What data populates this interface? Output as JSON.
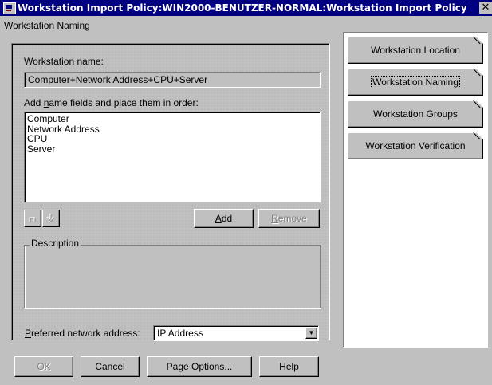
{
  "window": {
    "title": "Workstation Import Policy:WIN2000-BENUTZER-NORMAL:Workstation Import Policy",
    "close_glyph": "✕"
  },
  "page": {
    "heading": "Workstation Naming",
    "name_label": "Workstation name:",
    "name_value": "Computer+Network Address+CPU+Server",
    "fields_label_pre": "Add ",
    "fields_label_accel": "n",
    "fields_label_post": "ame fields and place them in order:",
    "fields": [
      "Computer",
      "Network Address",
      "CPU",
      "Server"
    ],
    "add_label_accel": "A",
    "add_label_rest": "dd",
    "remove_label_accel": "R",
    "remove_label_rest": "emove",
    "description_legend": "Description",
    "preferred_label_accel": "P",
    "preferred_label_rest": "referred network address:",
    "preferred_value": "IP Address"
  },
  "tabs": [
    {
      "label": "Workstation Location"
    },
    {
      "label": "Workstation Naming"
    },
    {
      "label": "Workstation Groups"
    },
    {
      "label": "Workstation Verification"
    }
  ],
  "footer": {
    "ok": "OK",
    "cancel": "Cancel",
    "page_options": "Page Options...",
    "help": "Help"
  },
  "icons": {
    "move_up": "move-up-icon",
    "move_down": "move-down-icon",
    "dropdown": "dropdown-arrow-icon"
  },
  "colors": {
    "titlebar": "#000080",
    "face": "#c0c0c0",
    "shadow": "#808080"
  }
}
